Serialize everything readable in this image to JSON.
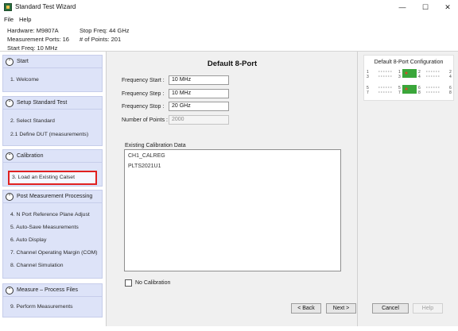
{
  "window": {
    "title": "Standard Test Wizard",
    "minimize_glyph": "—",
    "maximize_glyph": "☐",
    "close_glyph": "✕"
  },
  "menu": [
    "File",
    "Help"
  ],
  "info": {
    "hardware": "Hardware: M9807A",
    "stop_freq": "Stop Freq: 44 GHz",
    "measurement_ports": "Measurement Ports: 16",
    "num_points": "# of Points: 201",
    "start_freq": "Start Freq: 10 MHz"
  },
  "sidebar": {
    "groups": [
      {
        "title": "Start",
        "icon": "chevron-up-icon",
        "steps": [
          "1. Welcome"
        ]
      },
      {
        "title": "Setup Standard Test",
        "icon": "chevron-up-icon",
        "steps": [
          "2. Select Standard",
          "2.1 Define DUT   (measurements)"
        ]
      },
      {
        "title": "Calibration",
        "icon": "chevron-up-icon",
        "steps": [
          "3. Load an Existing Calset"
        ]
      },
      {
        "title": "Post Measurement Processing",
        "icon": "chevron-up-icon",
        "steps": [
          "4. N Port Reference Plane Adjust",
          "5. Auto-Save Measurements",
          "6. Auto Display",
          "7. Channel Operating Margin (COM)",
          "8. Channel Simulation"
        ]
      },
      {
        "title": "Measure – Process Files",
        "icon": "chevron-up-icon",
        "steps": [
          "9. Perform Measurements"
        ]
      }
    ],
    "collapse_glyph": "⌃",
    "active_step": "3. Load an Existing Calset"
  },
  "main": {
    "title": "Default 8-Port",
    "fields": [
      {
        "label": "Frequency Start :",
        "value": "10 MHz",
        "enabled": true
      },
      {
        "label": "Frequency Step :",
        "value": "10 MHz",
        "enabled": true
      },
      {
        "label": "Frequency Stop :",
        "value": "20 GHz",
        "enabled": true
      },
      {
        "label": "Number of Points :",
        "value": "2000",
        "enabled": false
      }
    ],
    "calibration_label": "Existing Calibration Data",
    "calibration_items": [
      "CH1_CALREG",
      "PLTS2021U1"
    ],
    "no_calibration_label": "No Calibration",
    "no_calibration_checked": false
  },
  "configuration": {
    "title": "Default 8-Port Configuration",
    "port_numbers": [
      "1",
      "3",
      "5",
      "7",
      "2",
      "4",
      "6",
      "8"
    ],
    "device_color": "#3aa63a",
    "marker_color": "#d64a2a"
  },
  "buttons": {
    "back": "< Back",
    "next": "Next >",
    "cancel": "Cancel",
    "help": "Help"
  }
}
